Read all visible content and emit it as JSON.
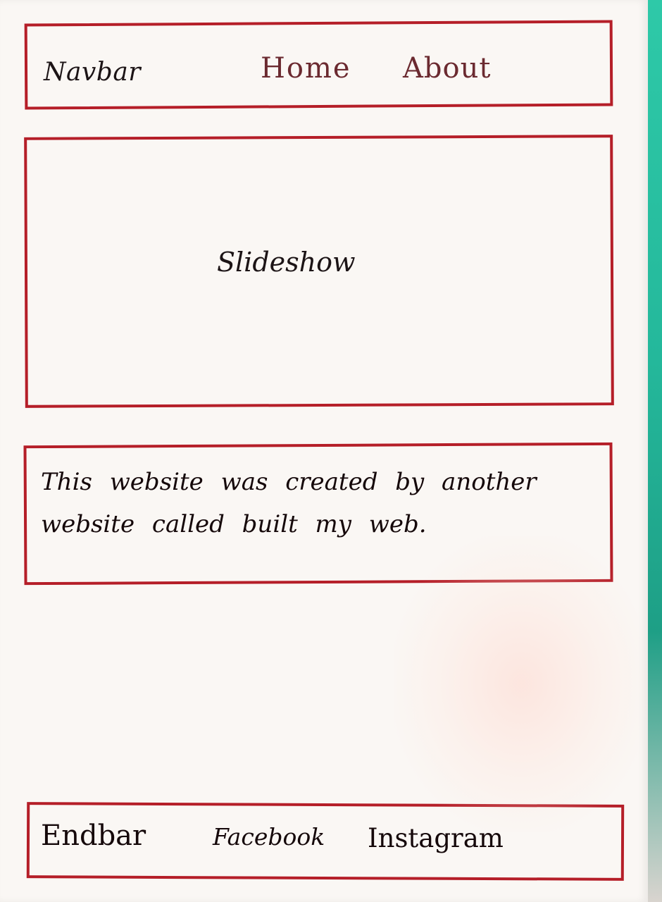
{
  "navbar": {
    "title": "Navbar",
    "links": [
      "Home",
      "About"
    ]
  },
  "slideshow": {
    "label": "Slideshow"
  },
  "description": {
    "line1": "This website was created by another",
    "line2": "website called built my web."
  },
  "endbar": {
    "title": "Endbar",
    "links": [
      "Facebook",
      "Instagram"
    ]
  },
  "colors": {
    "border": "#b51e28",
    "ink": "#15080a",
    "paper": "#faf7f4",
    "background": "#1fb596"
  }
}
